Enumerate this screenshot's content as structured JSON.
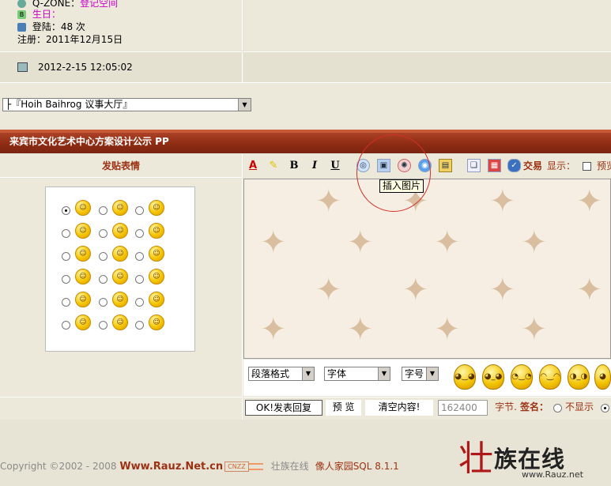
{
  "profile": {
    "qzone_label": "Q-ZONE：",
    "qzone_link": "登记空间",
    "birthday_label": "生日：",
    "login_label": "登陆：48 次",
    "register_label": "注册：2011年12月15日",
    "post_time": "2012-2-15 12:05:02"
  },
  "forum_select": {
    "value": "├『Hoih Baihrog 议事大厅』"
  },
  "thread": {
    "title": "来宾市文化艺术中心方案设计公示 PP"
  },
  "emoticons": {
    "header": "发贴表情",
    "faces": [
      "☺",
      "☺",
      "☺",
      "☺",
      "☺",
      "☺",
      "☺",
      "☺",
      "☺",
      "☺",
      "☺",
      "☺",
      "☺",
      "☺",
      "☺",
      "☺",
      "☺",
      "☺"
    ]
  },
  "toolbar": {
    "font_color": "A",
    "bold": "B",
    "italic": "I",
    "underline": "U",
    "trade_label": "交易",
    "display_label": "显示：",
    "preview_label": "预览",
    "tooltip": "插入图片"
  },
  "format": {
    "paragraph": "段落格式",
    "font": "字体",
    "size": "字号"
  },
  "actions": {
    "submit": "OK!发表回复",
    "preview": "预 览",
    "clear": "清空内容!",
    "char_count": "162400",
    "char_unit": "字节.",
    "sign_label": "签名：",
    "hide_option": "不显示"
  },
  "footer": {
    "copyright": "Copyright ©2002 - 2008 ",
    "site": "Www.Rauz.Net.cn",
    "cnzz": "CNZZ",
    "site_name": "壮族在线",
    "powered": "像人家园SQL 8.1.1",
    "logo_text": "壮族在线",
    "logo_url": "www.Rauz.net"
  },
  "colors": {
    "title_bar": "#8f2c13",
    "accent_red": "#9c3113",
    "link_purple": "#cc00cc"
  }
}
